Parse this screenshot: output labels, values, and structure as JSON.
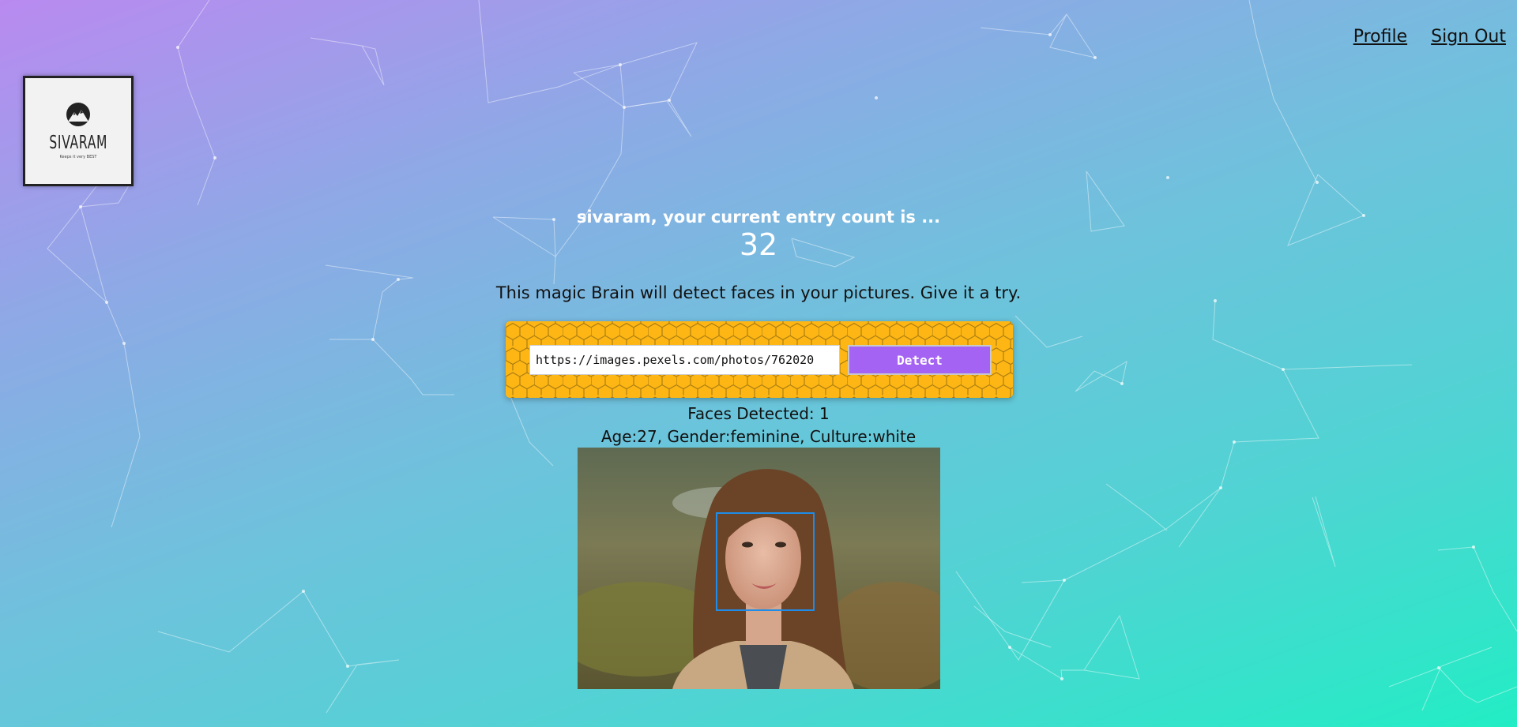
{
  "nav": {
    "profile": "Profile",
    "sign_out": "Sign Out"
  },
  "logo": {
    "name": "SIVARAM",
    "tagline": "Keeps it very BEST"
  },
  "entry": {
    "line": "sivaram, your current entry count is ...",
    "count": "32"
  },
  "tagline": "This magic Brain will detect faces in your pictures. Give it a try.",
  "form": {
    "url_value": "https://images.pexels.com/photos/762020",
    "detect_label": "Detect"
  },
  "result": {
    "faces_detected": "Faces Detected: 1",
    "details": "Age:27, Gender:feminine, Culture:white"
  },
  "colors": {
    "accent": "#a463f2",
    "panel": "#fdb614",
    "face_box": "#1e8ce8"
  }
}
